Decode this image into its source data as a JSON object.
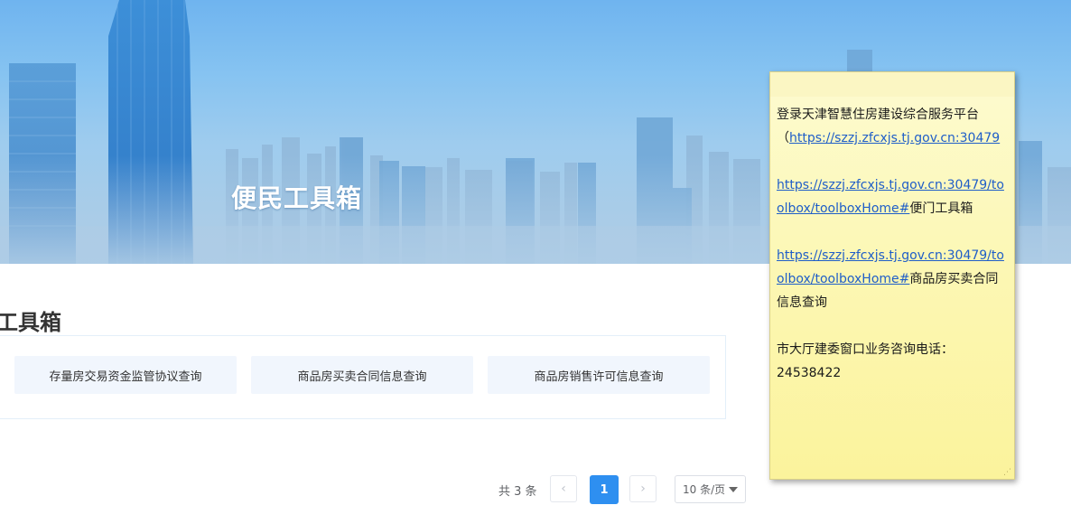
{
  "banner": {
    "title": "便民工具箱"
  },
  "section": {
    "title": "工具箱"
  },
  "tools": [
    "存量房交易资金监管协议查询",
    "商品房买卖合同信息查询",
    "商品房销售许可信息查询"
  ],
  "pagination": {
    "total_text": "共 3 条",
    "prev_icon": "‹",
    "current_page": "1",
    "next_icon": "›",
    "page_size": "10 条/页"
  },
  "note": {
    "line1": "登录天津智慧住房建设综合服务平台",
    "paren": "（",
    "link1": "https://szzj.zfcxjs.tj.gov.cn:30479",
    "link2": "https://szzj.zfcxjs.tj.gov.cn:30479/toolbox/toolboxHome#",
    "link2_suffix": "便门工具箱",
    "link3": "https://szzj.zfcxjs.tj.gov.cn:30479/toolbox/toolboxHome#",
    "link3_suffix": "商品房买卖合同信息查询",
    "phone_label": "市大厅建委窗口业务咨询电话：",
    "phone": "24538422"
  },
  "colors": {
    "accent": "#2e8ff0",
    "note_bg": "#fcf7b3",
    "link": "#1f5ec8"
  }
}
